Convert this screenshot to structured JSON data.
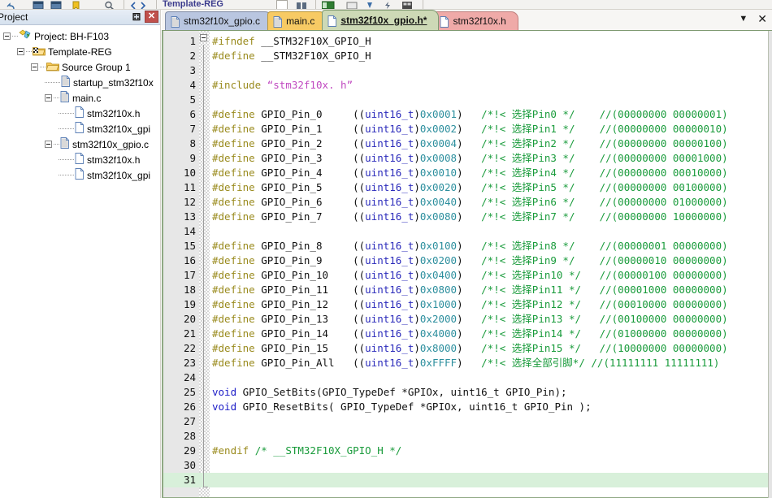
{
  "toolbar": {
    "project_name_label": "Template-REG",
    "icons": [
      "undo-icon",
      "window-icon",
      "window-icon",
      "bookmark-icon",
      "search-icon",
      "nav-back-icon",
      "nav-forward-icon",
      "checkbox-icon",
      "build-icon",
      "target-icon",
      "panel-icon",
      "debug-icon",
      "flash-icon",
      "config-icon"
    ]
  },
  "project_panel": {
    "title": "Project",
    "pin_icon": "pin-icon",
    "pin_glyph": "⚃",
    "close_icon": "close-icon",
    "close_glyph": "✕",
    "tree": [
      {
        "label": "Project: BH-F103",
        "depth": 0,
        "icon": "project-icon",
        "expander": "minus"
      },
      {
        "label": "Template-REG",
        "depth": 1,
        "icon": "target-folder-icon",
        "expander": "minus"
      },
      {
        "label": "Source Group 1",
        "depth": 2,
        "icon": "folder-icon",
        "expander": "minus"
      },
      {
        "label": "startup_stm32f10x",
        "depth": 3,
        "icon": "asm-file-icon",
        "expander": "none"
      },
      {
        "label": "main.c",
        "depth": 3,
        "icon": "c-file-icon",
        "expander": "minus"
      },
      {
        "label": "stm32f10x.h",
        "depth": 4,
        "icon": "h-file-icon",
        "expander": "none"
      },
      {
        "label": "stm32f10x_gpi",
        "depth": 4,
        "icon": "h-file-icon",
        "expander": "none"
      },
      {
        "label": "stm32f10x_gpio.c",
        "depth": 3,
        "icon": "c-file-icon",
        "expander": "minus"
      },
      {
        "label": "stm32f10x.h",
        "depth": 4,
        "icon": "h-file-icon",
        "expander": "none"
      },
      {
        "label": "stm32f10x_gpi",
        "depth": 4,
        "icon": "h-file-icon",
        "expander": "none"
      }
    ]
  },
  "editor": {
    "tabs": [
      {
        "label": "stm32f10x_gpio.c",
        "color": "#b9c6e0",
        "active": false,
        "modified": false,
        "icon": "c-file-icon"
      },
      {
        "label": "main.c",
        "color": "#f7ca64",
        "active": false,
        "modified": false,
        "icon": "c-file-icon"
      },
      {
        "label": "stm32f10x_gpio.h*",
        "color": "#cdd9b6",
        "active": true,
        "modified": true,
        "icon": "h-file-icon"
      },
      {
        "label": "stm32f10x.h",
        "color": "#efaaa8",
        "active": false,
        "modified": false,
        "icon": "h-file-icon"
      }
    ],
    "tab_dropdown_icon": "chevron-down-icon",
    "tab_dropdown_glyph": "▼",
    "tab_close_icon": "close-icon",
    "tab_close_glyph": "✕",
    "current_line": 31,
    "total_lines": 31,
    "colors": {
      "preprocessor": "#9a8b1e",
      "string": "#c048c0",
      "keyword": "#2020c8",
      "number": "#2d8f9e",
      "type": "#2b2bbb",
      "comment": "#199b3b",
      "plain": "#101010",
      "current_line_bg": "#d8f0da",
      "gutter_bg": "#e7e7e7"
    },
    "lines": [
      {
        "n": 1,
        "tokens": [
          {
            "t": "#ifndef ",
            "c": "pp"
          },
          {
            "t": "__STM32F10X_GPIO_H",
            "c": "plain"
          }
        ]
      },
      {
        "n": 2,
        "tokens": [
          {
            "t": "#define ",
            "c": "pp"
          },
          {
            "t": "__STM32F10X_GPIO_H",
            "c": "plain"
          }
        ]
      },
      {
        "n": 3,
        "tokens": []
      },
      {
        "n": 4,
        "tokens": [
          {
            "t": "#include ",
            "c": "pp"
          },
          {
            "t": "“stm32f10x. h”",
            "c": "str"
          }
        ]
      },
      {
        "n": 5,
        "tokens": []
      },
      {
        "n": 6,
        "tokens": [
          {
            "t": "#define",
            "c": "pp"
          },
          {
            "t": " GPIO_Pin_0     ((",
            "c": "plain"
          },
          {
            "t": "uint16_t",
            "c": "type"
          },
          {
            "t": ")",
            "c": "plain"
          },
          {
            "t": "0x0001",
            "c": "num"
          },
          {
            "t": ")   ",
            "c": "plain"
          },
          {
            "t": "/*!< 选择Pin0 */",
            "c": "cmt"
          },
          {
            "t": "    ",
            "c": "plain"
          },
          {
            "t": "//(00000000 00000001)",
            "c": "cmt"
          }
        ]
      },
      {
        "n": 7,
        "tokens": [
          {
            "t": "#define",
            "c": "pp"
          },
          {
            "t": " GPIO_Pin_1     ((",
            "c": "plain"
          },
          {
            "t": "uint16_t",
            "c": "type"
          },
          {
            "t": ")",
            "c": "plain"
          },
          {
            "t": "0x0002",
            "c": "num"
          },
          {
            "t": ")   ",
            "c": "plain"
          },
          {
            "t": "/*!< 选择Pin1 */",
            "c": "cmt"
          },
          {
            "t": "    ",
            "c": "plain"
          },
          {
            "t": "//(00000000 00000010)",
            "c": "cmt"
          }
        ]
      },
      {
        "n": 8,
        "tokens": [
          {
            "t": "#define",
            "c": "pp"
          },
          {
            "t": " GPIO_Pin_2     ((",
            "c": "plain"
          },
          {
            "t": "uint16_t",
            "c": "type"
          },
          {
            "t": ")",
            "c": "plain"
          },
          {
            "t": "0x0004",
            "c": "num"
          },
          {
            "t": ")   ",
            "c": "plain"
          },
          {
            "t": "/*!< 选择Pin2 */",
            "c": "cmt"
          },
          {
            "t": "    ",
            "c": "plain"
          },
          {
            "t": "//(00000000 00000100)",
            "c": "cmt"
          }
        ]
      },
      {
        "n": 9,
        "tokens": [
          {
            "t": "#define",
            "c": "pp"
          },
          {
            "t": " GPIO_Pin_3     ((",
            "c": "plain"
          },
          {
            "t": "uint16_t",
            "c": "type"
          },
          {
            "t": ")",
            "c": "plain"
          },
          {
            "t": "0x0008",
            "c": "num"
          },
          {
            "t": ")   ",
            "c": "plain"
          },
          {
            "t": "/*!< 选择Pin3 */",
            "c": "cmt"
          },
          {
            "t": "    ",
            "c": "plain"
          },
          {
            "t": "//(00000000 00001000)",
            "c": "cmt"
          }
        ]
      },
      {
        "n": 10,
        "tokens": [
          {
            "t": "#define",
            "c": "pp"
          },
          {
            "t": " GPIO_Pin_4     ((",
            "c": "plain"
          },
          {
            "t": "uint16_t",
            "c": "type"
          },
          {
            "t": ")",
            "c": "plain"
          },
          {
            "t": "0x0010",
            "c": "num"
          },
          {
            "t": ")   ",
            "c": "plain"
          },
          {
            "t": "/*!< 选择Pin4 */",
            "c": "cmt"
          },
          {
            "t": "    ",
            "c": "plain"
          },
          {
            "t": "//(00000000 00010000)",
            "c": "cmt"
          }
        ]
      },
      {
        "n": 11,
        "tokens": [
          {
            "t": "#define",
            "c": "pp"
          },
          {
            "t": " GPIO_Pin_5     ((",
            "c": "plain"
          },
          {
            "t": "uint16_t",
            "c": "type"
          },
          {
            "t": ")",
            "c": "plain"
          },
          {
            "t": "0x0020",
            "c": "num"
          },
          {
            "t": ")   ",
            "c": "plain"
          },
          {
            "t": "/*!< 选择Pin5 */",
            "c": "cmt"
          },
          {
            "t": "    ",
            "c": "plain"
          },
          {
            "t": "//(00000000 00100000)",
            "c": "cmt"
          }
        ]
      },
      {
        "n": 12,
        "tokens": [
          {
            "t": "#define",
            "c": "pp"
          },
          {
            "t": " GPIO_Pin_6     ((",
            "c": "plain"
          },
          {
            "t": "uint16_t",
            "c": "type"
          },
          {
            "t": ")",
            "c": "plain"
          },
          {
            "t": "0x0040",
            "c": "num"
          },
          {
            "t": ")   ",
            "c": "plain"
          },
          {
            "t": "/*!< 选择Pin6 */",
            "c": "cmt"
          },
          {
            "t": "    ",
            "c": "plain"
          },
          {
            "t": "//(00000000 01000000)",
            "c": "cmt"
          }
        ]
      },
      {
        "n": 13,
        "tokens": [
          {
            "t": "#define",
            "c": "pp"
          },
          {
            "t": " GPIO_Pin_7     ((",
            "c": "plain"
          },
          {
            "t": "uint16_t",
            "c": "type"
          },
          {
            "t": ")",
            "c": "plain"
          },
          {
            "t": "0x0080",
            "c": "num"
          },
          {
            "t": ")   ",
            "c": "plain"
          },
          {
            "t": "/*!< 选择Pin7 */",
            "c": "cmt"
          },
          {
            "t": "    ",
            "c": "plain"
          },
          {
            "t": "//(00000000 10000000)",
            "c": "cmt"
          }
        ]
      },
      {
        "n": 14,
        "tokens": []
      },
      {
        "n": 15,
        "tokens": [
          {
            "t": "#define",
            "c": "pp"
          },
          {
            "t": " GPIO_Pin_8     ((",
            "c": "plain"
          },
          {
            "t": "uint16_t",
            "c": "type"
          },
          {
            "t": ")",
            "c": "plain"
          },
          {
            "t": "0x0100",
            "c": "num"
          },
          {
            "t": ")   ",
            "c": "plain"
          },
          {
            "t": "/*!< 选择Pin8 */",
            "c": "cmt"
          },
          {
            "t": "    ",
            "c": "plain"
          },
          {
            "t": "//(00000001 00000000)",
            "c": "cmt"
          }
        ]
      },
      {
        "n": 16,
        "tokens": [
          {
            "t": "#define",
            "c": "pp"
          },
          {
            "t": " GPIO_Pin_9     ((",
            "c": "plain"
          },
          {
            "t": "uint16_t",
            "c": "type"
          },
          {
            "t": ")",
            "c": "plain"
          },
          {
            "t": "0x0200",
            "c": "num"
          },
          {
            "t": ")   ",
            "c": "plain"
          },
          {
            "t": "/*!< 选择Pin9 */",
            "c": "cmt"
          },
          {
            "t": "    ",
            "c": "plain"
          },
          {
            "t": "//(00000010 00000000)",
            "c": "cmt"
          }
        ]
      },
      {
        "n": 17,
        "tokens": [
          {
            "t": "#define",
            "c": "pp"
          },
          {
            "t": " GPIO_Pin_10    ((",
            "c": "plain"
          },
          {
            "t": "uint16_t",
            "c": "type"
          },
          {
            "t": ")",
            "c": "plain"
          },
          {
            "t": "0x0400",
            "c": "num"
          },
          {
            "t": ")   ",
            "c": "plain"
          },
          {
            "t": "/*!< 选择Pin10 */",
            "c": "cmt"
          },
          {
            "t": "   ",
            "c": "plain"
          },
          {
            "t": "//(00000100 00000000)",
            "c": "cmt"
          }
        ]
      },
      {
        "n": 18,
        "tokens": [
          {
            "t": "#define",
            "c": "pp"
          },
          {
            "t": " GPIO_Pin_11    ((",
            "c": "plain"
          },
          {
            "t": "uint16_t",
            "c": "type"
          },
          {
            "t": ")",
            "c": "plain"
          },
          {
            "t": "0x0800",
            "c": "num"
          },
          {
            "t": ")   ",
            "c": "plain"
          },
          {
            "t": "/*!< 选择Pin11 */",
            "c": "cmt"
          },
          {
            "t": "   ",
            "c": "plain"
          },
          {
            "t": "//(00001000 00000000)",
            "c": "cmt"
          }
        ]
      },
      {
        "n": 19,
        "tokens": [
          {
            "t": "#define",
            "c": "pp"
          },
          {
            "t": " GPIO_Pin_12    ((",
            "c": "plain"
          },
          {
            "t": "uint16_t",
            "c": "type"
          },
          {
            "t": ")",
            "c": "plain"
          },
          {
            "t": "0x1000",
            "c": "num"
          },
          {
            "t": ")   ",
            "c": "plain"
          },
          {
            "t": "/*!< 选择Pin12 */",
            "c": "cmt"
          },
          {
            "t": "   ",
            "c": "plain"
          },
          {
            "t": "//(00010000 00000000)",
            "c": "cmt"
          }
        ]
      },
      {
        "n": 20,
        "tokens": [
          {
            "t": "#define",
            "c": "pp"
          },
          {
            "t": " GPIO_Pin_13    ((",
            "c": "plain"
          },
          {
            "t": "uint16_t",
            "c": "type"
          },
          {
            "t": ")",
            "c": "plain"
          },
          {
            "t": "0x2000",
            "c": "num"
          },
          {
            "t": ")   ",
            "c": "plain"
          },
          {
            "t": "/*!< 选择Pin13 */",
            "c": "cmt"
          },
          {
            "t": "   ",
            "c": "plain"
          },
          {
            "t": "//(00100000 00000000)",
            "c": "cmt"
          }
        ]
      },
      {
        "n": 21,
        "tokens": [
          {
            "t": "#define",
            "c": "pp"
          },
          {
            "t": " GPIO_Pin_14    ((",
            "c": "plain"
          },
          {
            "t": "uint16_t",
            "c": "type"
          },
          {
            "t": ")",
            "c": "plain"
          },
          {
            "t": "0x4000",
            "c": "num"
          },
          {
            "t": ")   ",
            "c": "plain"
          },
          {
            "t": "/*!< 选择Pin14 */",
            "c": "cmt"
          },
          {
            "t": "   ",
            "c": "plain"
          },
          {
            "t": "//(01000000 00000000)",
            "c": "cmt"
          }
        ]
      },
      {
        "n": 22,
        "tokens": [
          {
            "t": "#define",
            "c": "pp"
          },
          {
            "t": " GPIO_Pin_15    ((",
            "c": "plain"
          },
          {
            "t": "uint16_t",
            "c": "type"
          },
          {
            "t": ")",
            "c": "plain"
          },
          {
            "t": "0x8000",
            "c": "num"
          },
          {
            "t": ")   ",
            "c": "plain"
          },
          {
            "t": "/*!< 选择Pin15 */",
            "c": "cmt"
          },
          {
            "t": "   ",
            "c": "plain"
          },
          {
            "t": "//(10000000 00000000)",
            "c": "cmt"
          }
        ]
      },
      {
        "n": 23,
        "tokens": [
          {
            "t": "#define",
            "c": "pp"
          },
          {
            "t": " GPIO_Pin_All   ((",
            "c": "plain"
          },
          {
            "t": "uint16_t",
            "c": "type"
          },
          {
            "t": ")",
            "c": "plain"
          },
          {
            "t": "0xFFFF",
            "c": "num"
          },
          {
            "t": ")   ",
            "c": "plain"
          },
          {
            "t": "/*!< 选择全部引脚*/",
            "c": "cmt"
          },
          {
            "t": " ",
            "c": "plain"
          },
          {
            "t": "//(11111111 11111111)",
            "c": "cmt"
          }
        ]
      },
      {
        "n": 24,
        "tokens": []
      },
      {
        "n": 25,
        "tokens": [
          {
            "t": "void",
            "c": "kw"
          },
          {
            "t": " GPIO_SetBits(GPIO_TypeDef *GPIOx, uint16_t GPIO_Pin);",
            "c": "plain"
          }
        ]
      },
      {
        "n": 26,
        "tokens": [
          {
            "t": "void",
            "c": "kw"
          },
          {
            "t": " GPIO_ResetBits( GPIO_TypeDef *GPIOx, uint16_t GPIO_Pin );",
            "c": "plain"
          }
        ]
      },
      {
        "n": 27,
        "tokens": []
      },
      {
        "n": 28,
        "tokens": []
      },
      {
        "n": 29,
        "tokens": [
          {
            "t": "#endif ",
            "c": "pp"
          },
          {
            "t": "/* __STM32F10X_GPIO_H */",
            "c": "cmt"
          }
        ]
      },
      {
        "n": 30,
        "tokens": []
      },
      {
        "n": 31,
        "tokens": []
      }
    ]
  }
}
